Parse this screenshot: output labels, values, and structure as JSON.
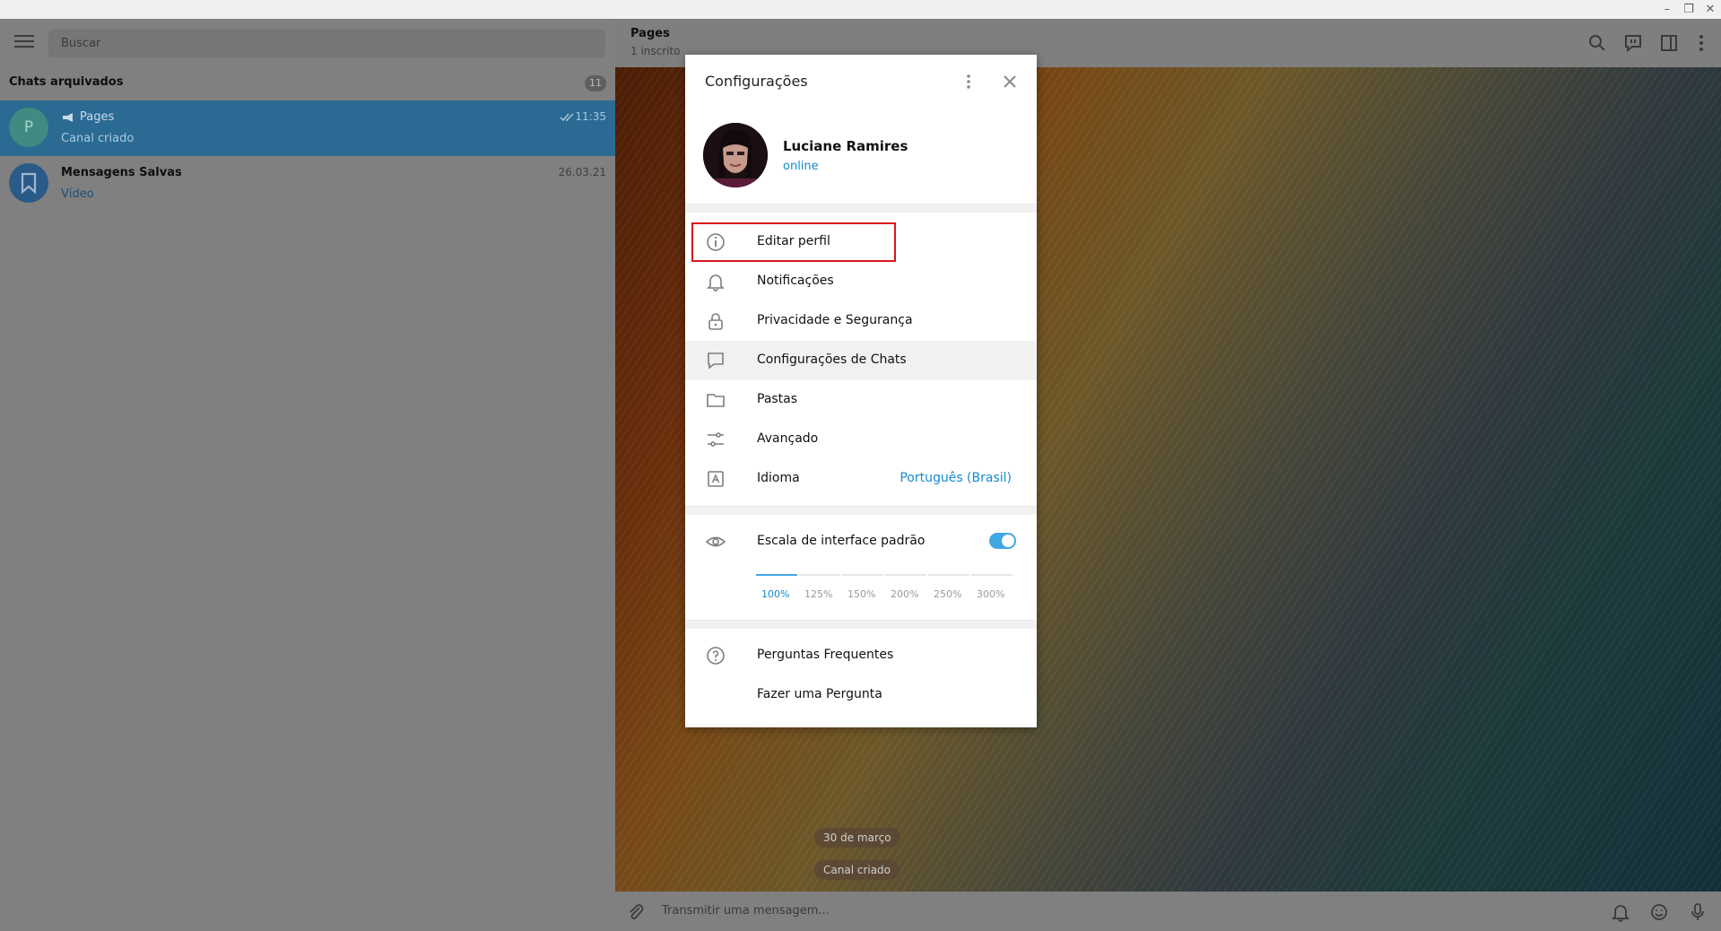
{
  "window": {
    "minimize": "–",
    "restore": "❐",
    "close": "✕"
  },
  "sidebar": {
    "search_placeholder": "Buscar",
    "section_title": "Chats arquivados",
    "section_count": "11",
    "chats": [
      {
        "avatar_letter": "P",
        "name": "Pages",
        "time": "11:35",
        "subtitle": "Canal criado",
        "active": true,
        "icon": "megaphone-icon"
      },
      {
        "avatar_letter": "",
        "name": "Mensagens Salvas",
        "time": "26.03.21",
        "subtitle": "Vídeo",
        "active": false,
        "icon": "bookmark-icon"
      }
    ]
  },
  "chat": {
    "title": "Pages",
    "subtitle": "1 inscrito",
    "service_messages": [
      "30 de março",
      "Canal criado"
    ],
    "composer_placeholder": "Transmitir uma mensagem..."
  },
  "settings": {
    "title": "Configurações",
    "profile": {
      "name": "Luciane Ramires",
      "status": "online"
    },
    "menu": [
      {
        "label": "Editar perfil",
        "icon": "info-icon"
      },
      {
        "label": "Notificações",
        "icon": "bell-icon"
      },
      {
        "label": "Privacidade e Segurança",
        "icon": "lock-icon"
      },
      {
        "label": "Configurações de Chats",
        "icon": "chat-bubble-icon"
      },
      {
        "label": "Pastas",
        "icon": "folder-icon"
      },
      {
        "label": "Avançado",
        "icon": "sliders-icon"
      },
      {
        "label": "Idioma",
        "icon": "language-icon",
        "value": "Português (Brasil)"
      }
    ],
    "scale": {
      "label": "Escala de interface padrão",
      "enabled": true,
      "options": [
        "100%",
        "125%",
        "150%",
        "200%",
        "250%",
        "300%"
      ],
      "selected": "100%"
    },
    "help": [
      {
        "label": "Perguntas Frequentes",
        "icon": "question-icon"
      },
      {
        "label": "Fazer uma Pergunta",
        "icon": ""
      }
    ]
  },
  "colors": {
    "accent": "#168acd",
    "highlight": "#d8161d",
    "toggle": "#40a7e3"
  }
}
